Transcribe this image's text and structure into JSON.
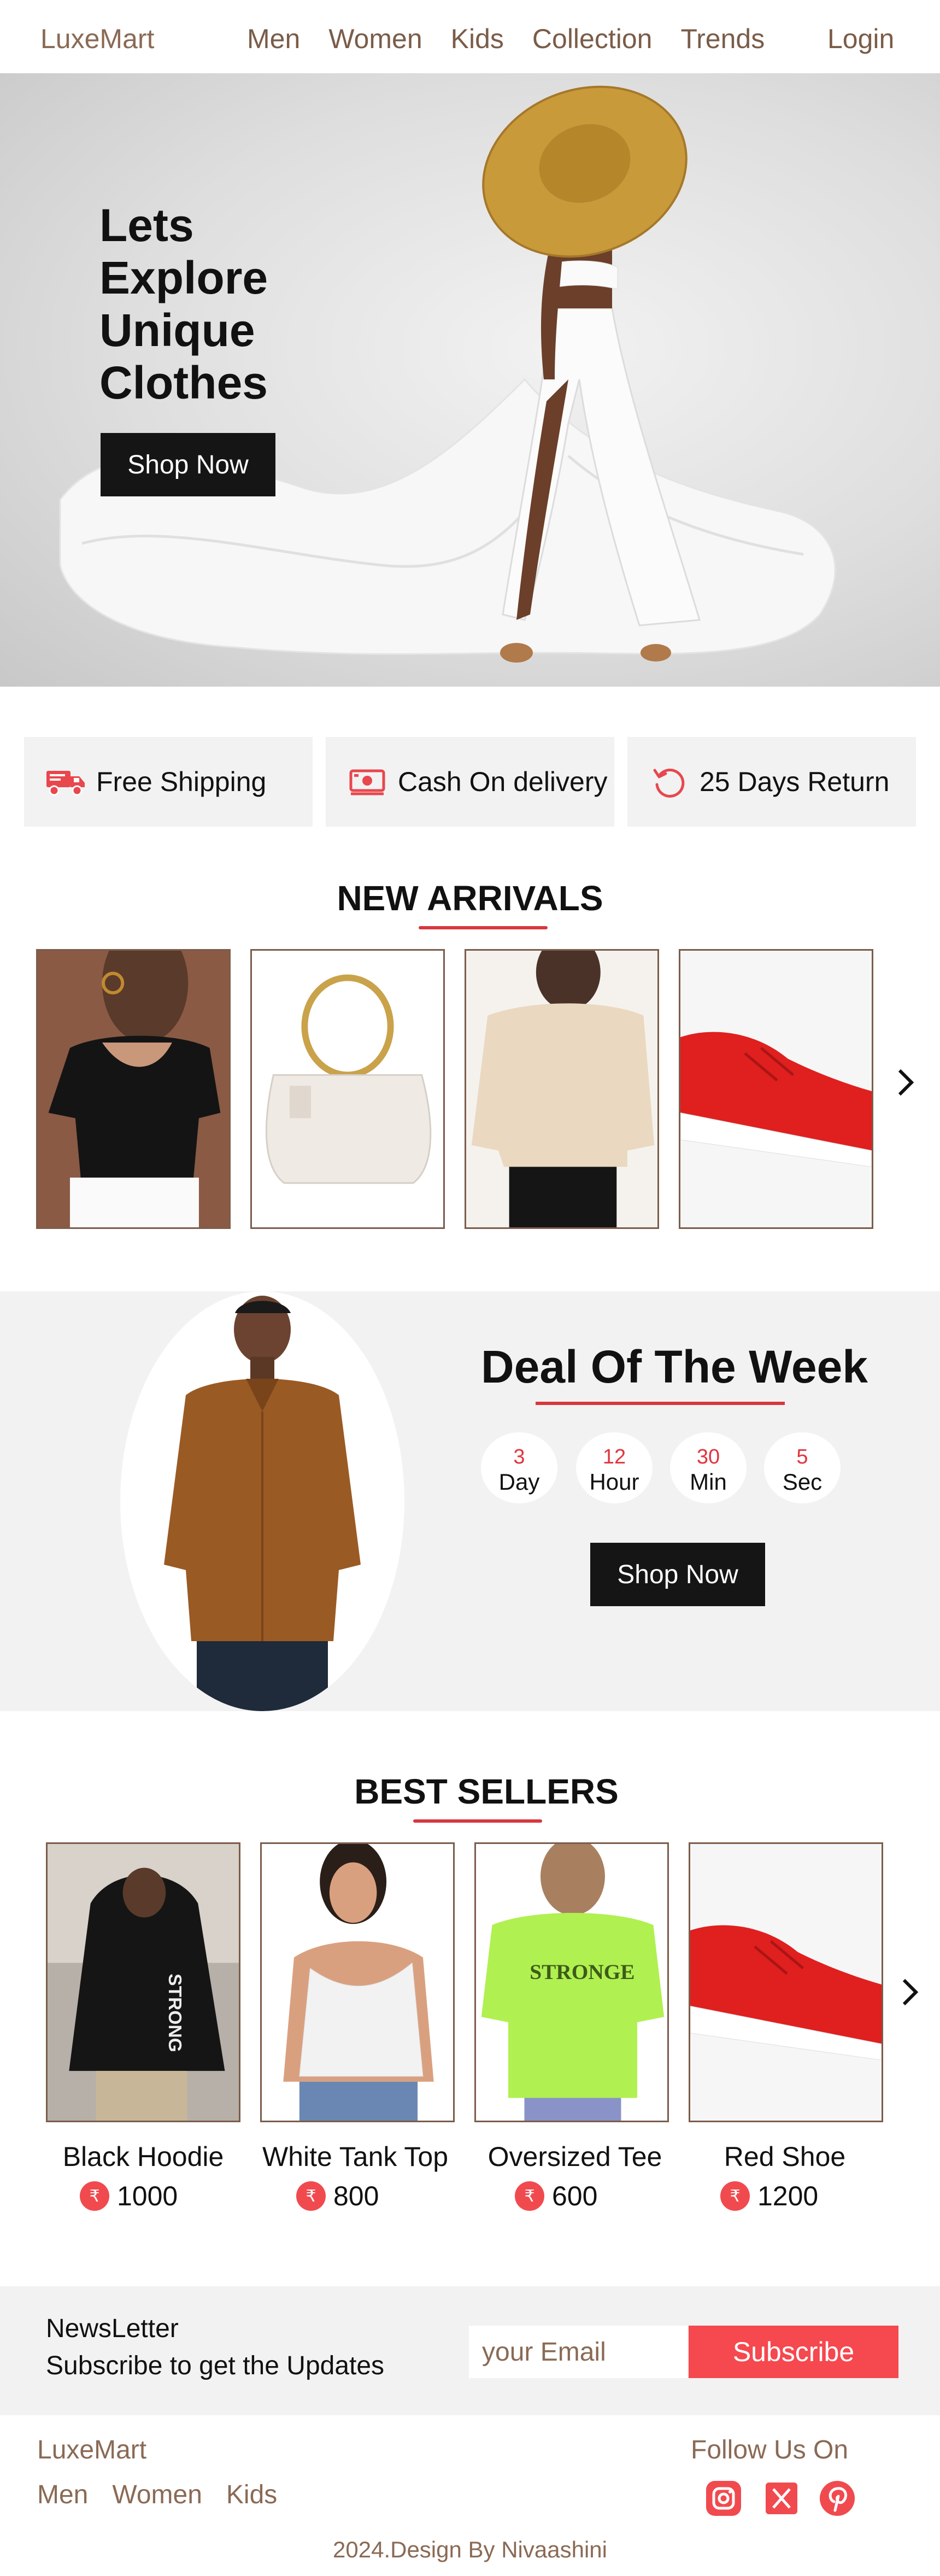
{
  "nav": {
    "logo": "LuxeMart",
    "links": [
      "Men",
      "Women",
      "Kids",
      "Collection",
      "Trends"
    ],
    "login": "Login"
  },
  "hero": {
    "heading_lines": [
      "Lets",
      "Explore",
      "Unique",
      "Clothes"
    ],
    "cta": "Shop Now"
  },
  "features": [
    {
      "icon": "truck-icon",
      "label": "Free Shipping"
    },
    {
      "icon": "cash-icon",
      "label": "Cash On delivery"
    },
    {
      "icon": "return-icon",
      "label": "25 Days Return"
    }
  ],
  "new_arrivals": {
    "title": "NEW ARRIVALS",
    "items": [
      {
        "image": "black-top-image"
      },
      {
        "image": "white-handbag-image"
      },
      {
        "image": "beige-sweatshirt-image"
      },
      {
        "image": "red-shoe-image"
      }
    ],
    "next_icon": "chevron-right-icon"
  },
  "deal": {
    "title": "Deal Of The Week",
    "countdown": [
      {
        "value": "3",
        "unit": "Day"
      },
      {
        "value": "12",
        "unit": "Hour"
      },
      {
        "value": "30",
        "unit": "Min"
      },
      {
        "value": "5",
        "unit": "Sec"
      }
    ],
    "cta": "Shop Now"
  },
  "best_sellers": {
    "title": "BEST SELLERS",
    "currency_icon": "rupee-icon",
    "currency_symbol": "₹",
    "items": [
      {
        "name": "Black Hoodie",
        "price": "1000"
      },
      {
        "name": "White Tank Top",
        "price": "800"
      },
      {
        "name": "Oversized Tee",
        "price": "600"
      },
      {
        "name": "Red Shoe",
        "price": "1200"
      }
    ],
    "next_icon": "chevron-right-icon"
  },
  "newsletter": {
    "title": "NewsLetter",
    "subtitle": "Subscribe to get the Updates",
    "email_placeholder": "your Email",
    "subscribe": "Subscribe"
  },
  "footer": {
    "brand": "LuxeMart",
    "links": [
      "Men",
      "Women",
      "Kids"
    ],
    "follow": "Follow Us On",
    "social": [
      "instagram-icon",
      "x-icon",
      "pinterest-icon"
    ],
    "credit": "2024.Design By Nivaashini"
  },
  "colors": {
    "accent": "#f5484f",
    "brand_brown": "#8a6a55",
    "dark_button": "#151515",
    "panel_gray": "#f2f2f2"
  }
}
